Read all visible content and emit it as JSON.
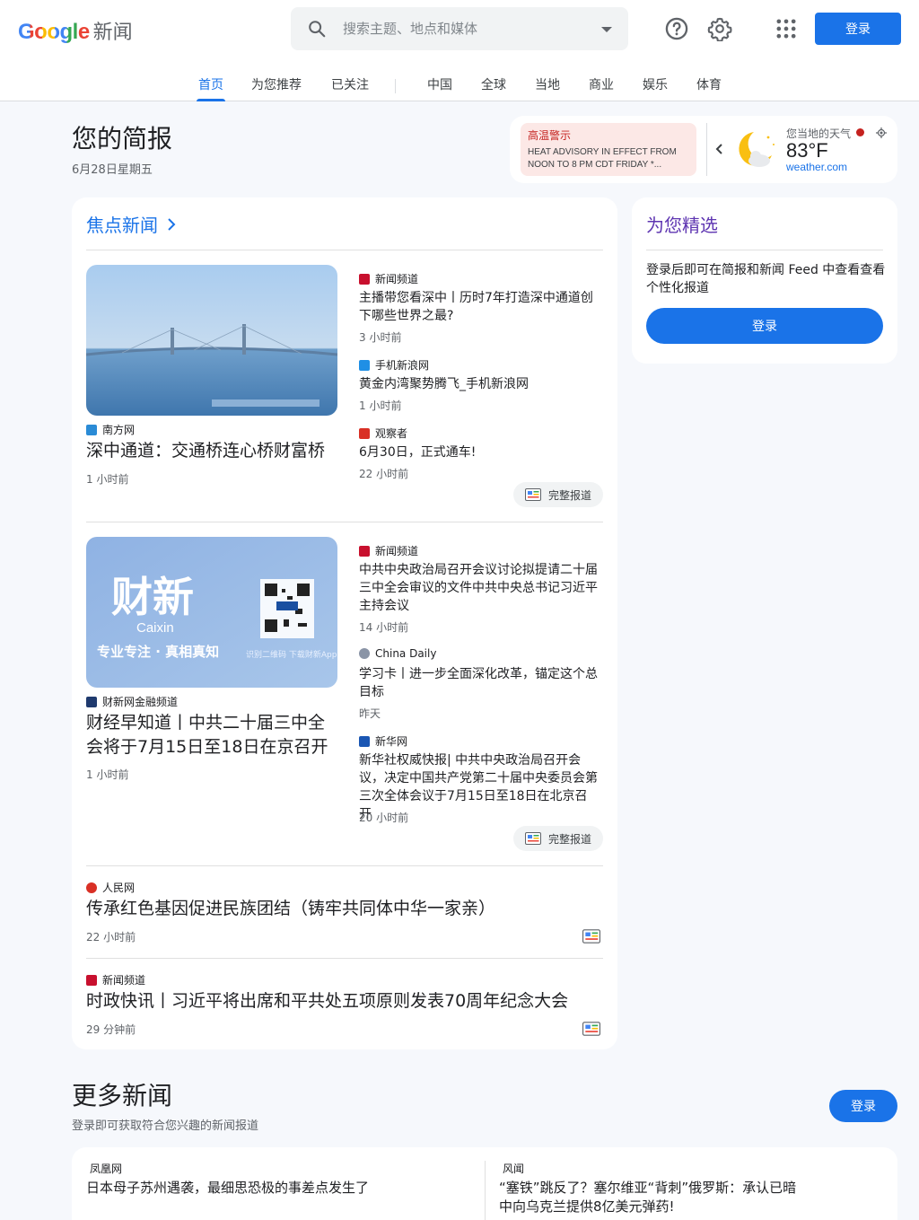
{
  "header": {
    "logo_brand": "Google",
    "logo_product": "新闻",
    "search_placeholder": "搜索主题、地点和媒体",
    "login_label": "登录"
  },
  "tabs": [
    {
      "label": "首页",
      "active": true
    },
    {
      "label": "为您推荐"
    },
    {
      "label": "已关注"
    },
    {
      "label": "中国"
    },
    {
      "label": "全球"
    },
    {
      "label": "当地"
    },
    {
      "label": "商业"
    },
    {
      "label": "娱乐"
    },
    {
      "label": "体育"
    }
  ],
  "briefing": {
    "title": "您的简报",
    "date": "6月28日星期五"
  },
  "weather": {
    "alert_title": "高温警示",
    "alert_desc": "HEAT ADVISORY IN EFFECT FROM NOON TO 8 PM CDT FRIDAY *...",
    "label": "您当地的天气",
    "temp": "83°F",
    "source": "weather.com",
    "icon": "partly-cloudy-night-icon"
  },
  "stories": {
    "heading": "焦点新闻",
    "full_coverage": "完整报道",
    "clusters": [
      {
        "main": {
          "source": "南方网",
          "headline": "深中通道：交通桥连心桥财富桥",
          "time": "1 小时前"
        },
        "side": [
          {
            "source": "新闻频道",
            "headline": "主播带您看深中丨历时7年打造深中通道创下哪些世界之最?",
            "time": "3 小时前"
          },
          {
            "source": "手机新浪网",
            "headline": "黄金内湾聚势腾飞_手机新浪网",
            "time": "1 小时前"
          },
          {
            "source": "观察者",
            "headline": "6月30日，正式通车!",
            "time": "22 小时前"
          }
        ]
      },
      {
        "main": {
          "source": "财新网金融频道",
          "headline": "财经早知道丨中共二十届三中全会将于7月15日至18日在京召开",
          "time": "1 小时前",
          "image_text": {
            "brand": "财新",
            "latin": "Caixin",
            "slogan": "专业专注 · 真相真知",
            "qr_caption": "识别二维码 下载财新App"
          }
        },
        "side": [
          {
            "source": "新闻频道",
            "headline": "中共中央政治局召开会议讨论拟提请二十届三中全会审议的文件中共中央总书记习近平主持会议",
            "time": "14 小时前"
          },
          {
            "source": "China Daily",
            "headline": "学习卡丨进一步全面深化改革，锚定这个总目标",
            "time": "昨天"
          },
          {
            "source": "新华网",
            "headline": "新华社权威快报| 中共中央政治局召开会议，决定中国共产党第二十届中央委员会第三次全体会议于7月15日至18日在北京召开",
            "time": "20 小时前"
          }
        ]
      }
    ],
    "singles": [
      {
        "source": "人民网",
        "headline": "传承红色基因促进民族团结（铸牢共同体中华一家亲）",
        "time": "22 小时前"
      },
      {
        "source": "新闻频道",
        "headline": "时政快讯丨习近平将出席和平共处五项原则发表70周年纪念大会",
        "time": "29 分钟前"
      }
    ]
  },
  "for_you": {
    "title": "为您精选",
    "text": "登录后即可在简报和新闻 Feed 中查看查看个性化报道",
    "button": "登录"
  },
  "more": {
    "title": "更多新闻",
    "subtitle": "登录即可获取符合您兴趣的新闻报道",
    "button": "登录",
    "items": [
      {
        "source": "凤凰网",
        "headline": "日本母子苏州遇袭，最细思恐极的事差点发生了"
      },
      {
        "source": "风闻",
        "headline": "“塞铁”跳反了？塞尔维亚“背刺”俄罗斯：承认已暗中向乌克兰提供8亿美元弹药!"
      }
    ]
  },
  "colors": {
    "accent": "#1a73e8",
    "for_you": "#5e35b1",
    "alert": "#c5221f"
  }
}
